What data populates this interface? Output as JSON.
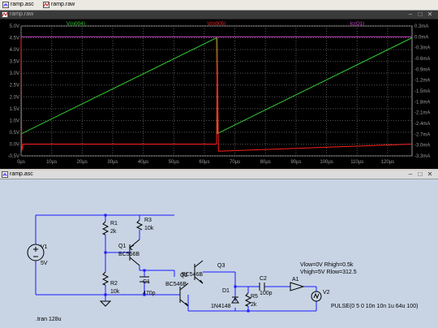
{
  "tabs": [
    {
      "label": "ramp.asc"
    },
    {
      "label": "ramp.raw"
    }
  ],
  "plot_window": {
    "title": "ramp.raw"
  },
  "schematic_window": {
    "title": "ramp.asc"
  },
  "window_buttons": {
    "minimize": "–",
    "maximize": "□",
    "close": "✕"
  },
  "colors": {
    "plot_bg": "#000000",
    "grid": "#555555",
    "axis_text": "#9a9a9a",
    "v_n004": "#33cc33",
    "v_n005": "#ff2020",
    "ic_q1": "#cc44cc",
    "schematic_bg": "#c8d4e4",
    "wire": "#1a1aff",
    "component": "#000000"
  },
  "chart_data": {
    "type": "line",
    "traces": [
      {
        "name": "V(n004)",
        "axis": "left",
        "color": "#33cc33"
      },
      {
        "name": "V(n005)",
        "axis": "left",
        "color": "#ff2020"
      },
      {
        "name": "Ic(Q1)",
        "axis": "right",
        "color": "#cc44cc"
      }
    ],
    "left_axis": {
      "unit": "V",
      "ticks": [
        "5.0V",
        "4.5V",
        "4.0V",
        "3.5V",
        "3.0V",
        "2.5V",
        "2.0V",
        "1.5V",
        "1.0V",
        "0.5V",
        "0.0V",
        "-0.5V"
      ],
      "ylim": [
        -0.5,
        5.0
      ]
    },
    "right_axis": {
      "unit": "mA",
      "ticks": [
        "0.3mA",
        "0.0mA",
        "-0.3mA",
        "-0.6mA",
        "-0.9mA",
        "-1.2mA",
        "-1.5mA",
        "-1.8mA",
        "-2.1mA",
        "-2.4mA",
        "-2.7mA",
        "-3.0mA",
        "-3.3mA"
      ],
      "ylim": [
        -3.3,
        0.3
      ]
    },
    "x_axis": {
      "unit": "µs",
      "ticks": [
        "0µs",
        "10µs",
        "20µs",
        "30µs",
        "40µs",
        "50µs",
        "60µs",
        "70µs",
        "80µs",
        "90µs",
        "100µs",
        "110µs",
        "120µs"
      ],
      "xlim": [
        0,
        128
      ]
    },
    "series": [
      {
        "name": "V(n004)",
        "x": [
          0,
          0.3,
          64,
          64.3,
          128
        ],
        "y": [
          0.45,
          0.45,
          4.5,
          0.45,
          4.5
        ]
      },
      {
        "name": "V(n005)",
        "x": [
          0,
          0.2,
          0.6,
          64,
          64.2,
          64.6,
          128
        ],
        "y": [
          4.5,
          -0.3,
          0.0,
          0.0,
          4.5,
          -0.3,
          0.0
        ]
      },
      {
        "name": "Ic(Q1)",
        "x": [
          0,
          0.3,
          128
        ],
        "y": [
          0.0,
          0.0,
          0.0
        ]
      }
    ]
  },
  "schematic": {
    "components": [
      {
        "ref": "R1",
        "value": "2k"
      },
      {
        "ref": "R3",
        "value": "10k"
      },
      {
        "ref": "Q1",
        "value": "BC556B"
      },
      {
        "ref": "R2",
        "value": "10k"
      },
      {
        "ref": "C1",
        "value": "470p"
      },
      {
        "ref": "Q2",
        "value": "BC546B"
      },
      {
        "ref": "Q3",
        "value": "BC546B"
      },
      {
        "ref": "D1",
        "value": "1N4148"
      },
      {
        "ref": "R5",
        "value": "2k"
      },
      {
        "ref": "C2",
        "value": "100p"
      },
      {
        "ref": "A1",
        "value": ""
      },
      {
        "ref": "V1",
        "value": "5V"
      },
      {
        "ref": "V2",
        "value": "PULSE(0 5 0 10n 10n 1u 64u 100)"
      }
    ],
    "directive": ".tran 128u",
    "digital_params": [
      "Vlow=0V Rhigh=0.5k",
      "Vhigh=5V Rlow=312.5"
    ]
  }
}
